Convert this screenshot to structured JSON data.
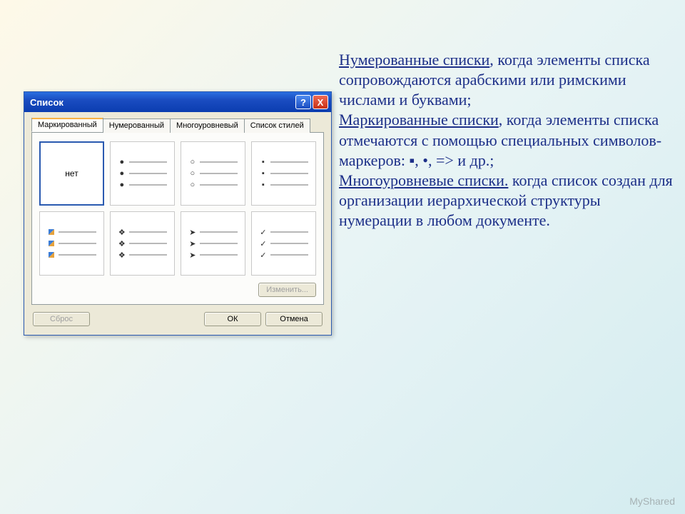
{
  "dialog": {
    "title": "Список",
    "tabs": [
      "Маркированный",
      "Нумерованный",
      "Многоуровневый",
      "Список стилей"
    ],
    "activeTab": 0,
    "noneLabel": "нет",
    "buttons": {
      "modify": "Изменить...",
      "reset": "Сброс",
      "ok": "ОК",
      "cancel": "Отмена"
    },
    "titlebarHelp": "?",
    "titlebarClose": "X"
  },
  "bulletStyles": [
    "none",
    "disc",
    "circle",
    "square",
    "image-book",
    "diamond-outline",
    "chevron",
    "check"
  ],
  "text": {
    "term1": "Нумерованные списки",
    "body1": ", когда элементы списка сопровождаются арабскими или римскими числами и буквами;",
    "term2": "Маркированные списки",
    "body2": ", когда элементы списка отмечаются с помощью специальных символов-маркеров:  ▪, •,  => и др.;",
    "term3": "Многоуровневые списки.",
    "body3": " когда список создан для организации иерархической структуры нумерации в любом документе."
  },
  "watermark": "MyShared"
}
